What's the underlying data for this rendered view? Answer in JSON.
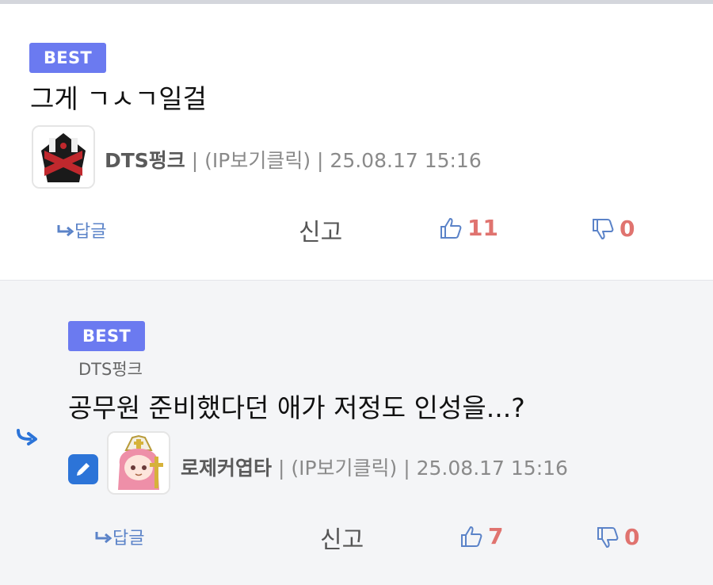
{
  "comments": [
    {
      "badge": "BEST",
      "text": "그게 ㄱㅅㄱ일걸",
      "nickname": "DTS펑크",
      "ip": "| (IP보기클릭) |",
      "date": "25.08.17 15:16",
      "reply_label": "답글",
      "report_label": "신고",
      "likes": "11",
      "dislikes": "0"
    },
    {
      "badge": "BEST",
      "parent_name": "DTS펑크",
      "text": "공무원 준비했다던 애가 저정도 인성을...?",
      "nickname": "로제커엽타",
      "ip": "| (IP보기클릭) |",
      "date": "25.08.17 15:16",
      "reply_label": "답글",
      "report_label": "신고",
      "likes": "7",
      "dislikes": "0"
    }
  ],
  "colors": {
    "badge": "#6b7af0",
    "accent": "#5b83c8",
    "count": "#e0736f",
    "edit": "#2c74d8"
  },
  "icons": {
    "reply_arrow": "reply-arrow-icon",
    "like": "thumbs-up-icon",
    "dislike": "thumbs-down-icon",
    "edit": "pencil-icon",
    "reply_indicator": "reply-indicator-arrow-icon"
  }
}
